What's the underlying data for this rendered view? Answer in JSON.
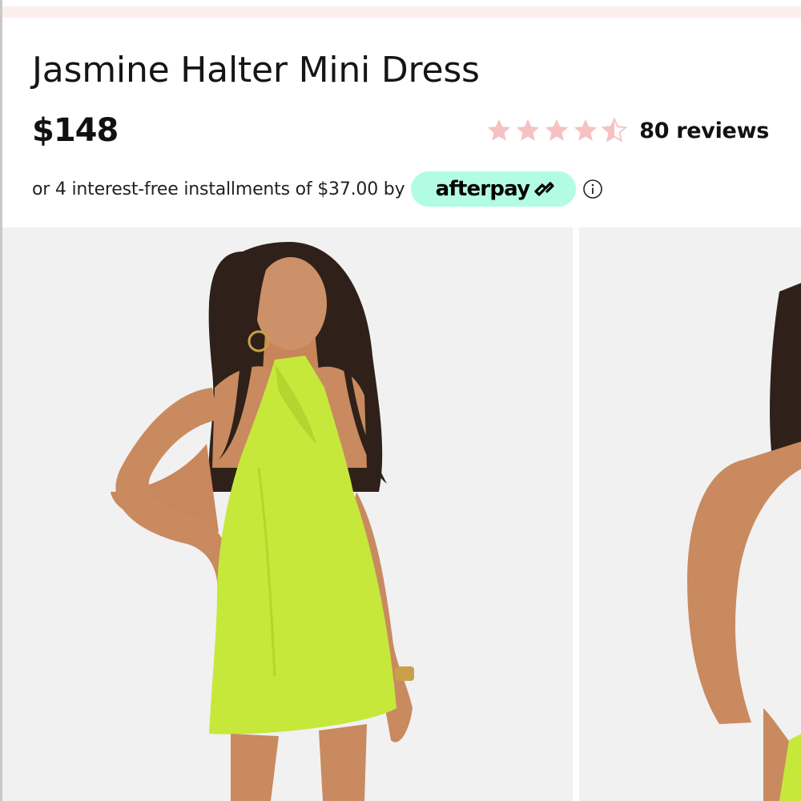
{
  "product": {
    "title": "Jasmine Halter Mini Dress",
    "price": "$148"
  },
  "rating": {
    "value": 4.5,
    "max": 5,
    "star_color": "#f6c1c1",
    "reviews_label": "80 reviews"
  },
  "installments": {
    "text": "or 4 interest-free installments of $37.00 by",
    "provider": "afterpay",
    "provider_bg_color": "#b2fce4",
    "provider_icon": "afterpay-arrows-icon",
    "info_icon": "info-icon"
  },
  "gallery": {
    "images": [
      {
        "name": "model-front-photo",
        "dress_color": "#c6e83a"
      },
      {
        "name": "model-back-photo",
        "dress_color": "#c6e83a"
      }
    ]
  }
}
